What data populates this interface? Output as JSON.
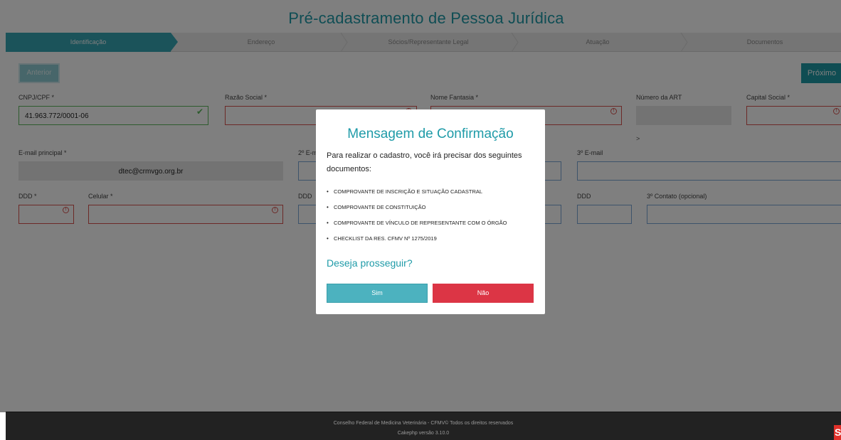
{
  "page": {
    "title": "Pré-cadastramento de Pessoa Jurídica"
  },
  "stepper": {
    "steps": [
      {
        "label": "Identificação",
        "active": true
      },
      {
        "label": "Endereço",
        "active": false
      },
      {
        "label": "Sócios/Representante Legal",
        "active": false
      },
      {
        "label": "Atuação",
        "active": false
      },
      {
        "label": "Documentos",
        "active": false
      }
    ]
  },
  "nav": {
    "prev_label": "Anterior",
    "next_label": "Próximo"
  },
  "form": {
    "cnpj_label": "CNPJ/CPF *",
    "cnpj_value": "41.963.772/0001-06",
    "razao_label": "Razão Social *",
    "fantasia_label": "Nome Fantasia *",
    "art_label": "Número da ART",
    "capital_label": "Capital Social *",
    "gt_mark": ">",
    "email_label": "E-mail principal *",
    "email_value": "dtec@crmvgo.org.br",
    "email2_label": "2º E-mail",
    "email3_label": "3º E-mail",
    "ddd_label": "DDD *",
    "celular_label": "Celular *",
    "ddd2_label": "DDD",
    "ddd3_label": "DDD",
    "contato3_label": "3º Contato (opcional)"
  },
  "modal": {
    "title": "Mensagem de Confirmação",
    "intro": "Para realizar o cadastro, você irá precisar dos seguintes documentos:",
    "documents": [
      "COMPROVANTE DE INSCRIÇÃO E SITUAÇÃO CADASTRAL",
      "COMPROVANTE DE CONSTITUIÇÃO",
      "COMPROVANTE DE VÍNCULO DE REPRESENTANTE COM O ÓRGÃO",
      "CHECKLIST DA RES. CFMV Nº 1275/2019"
    ],
    "question": "Deseja prosseguir?",
    "yes_label": "Sim",
    "no_label": "Não"
  },
  "footer": {
    "line1": "Conselho Federal de Medicina Veterinária - CFMV© Todos os direitos reservados",
    "line2": "Cakephp versão 3.10.0",
    "badge": "S"
  },
  "colors": {
    "accent": "#1f9ba8",
    "step_active": "#36a6b4",
    "error": "#d9534f",
    "success": "#5cb85c",
    "danger_button": "#dc3545",
    "footer_bg": "#222222"
  }
}
